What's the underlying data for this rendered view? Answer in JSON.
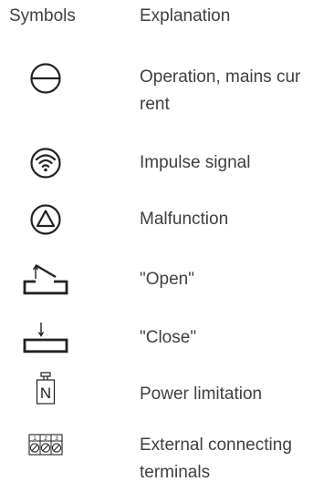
{
  "header": {
    "symbols": "Symbols",
    "explanation": "Explanation"
  },
  "rows": [
    {
      "icon": "circle-minus-icon",
      "text": "Operation, mains cur rent"
    },
    {
      "icon": "wifi-signal-icon",
      "text": "Impulse signal"
    },
    {
      "icon": "warning-triangle-icon",
      "text": "Malfunction"
    },
    {
      "icon": "open-arrow-icon",
      "text": "\"Open\""
    },
    {
      "icon": "close-arrow-icon",
      "text": "\"Close\""
    },
    {
      "icon": "power-limit-n-icon",
      "text": "Power limitation"
    },
    {
      "icon": "terminal-block-icon",
      "text": "External connecting terminals"
    }
  ],
  "colors": {
    "stroke": "#222222",
    "text": "#3f3f3f"
  }
}
